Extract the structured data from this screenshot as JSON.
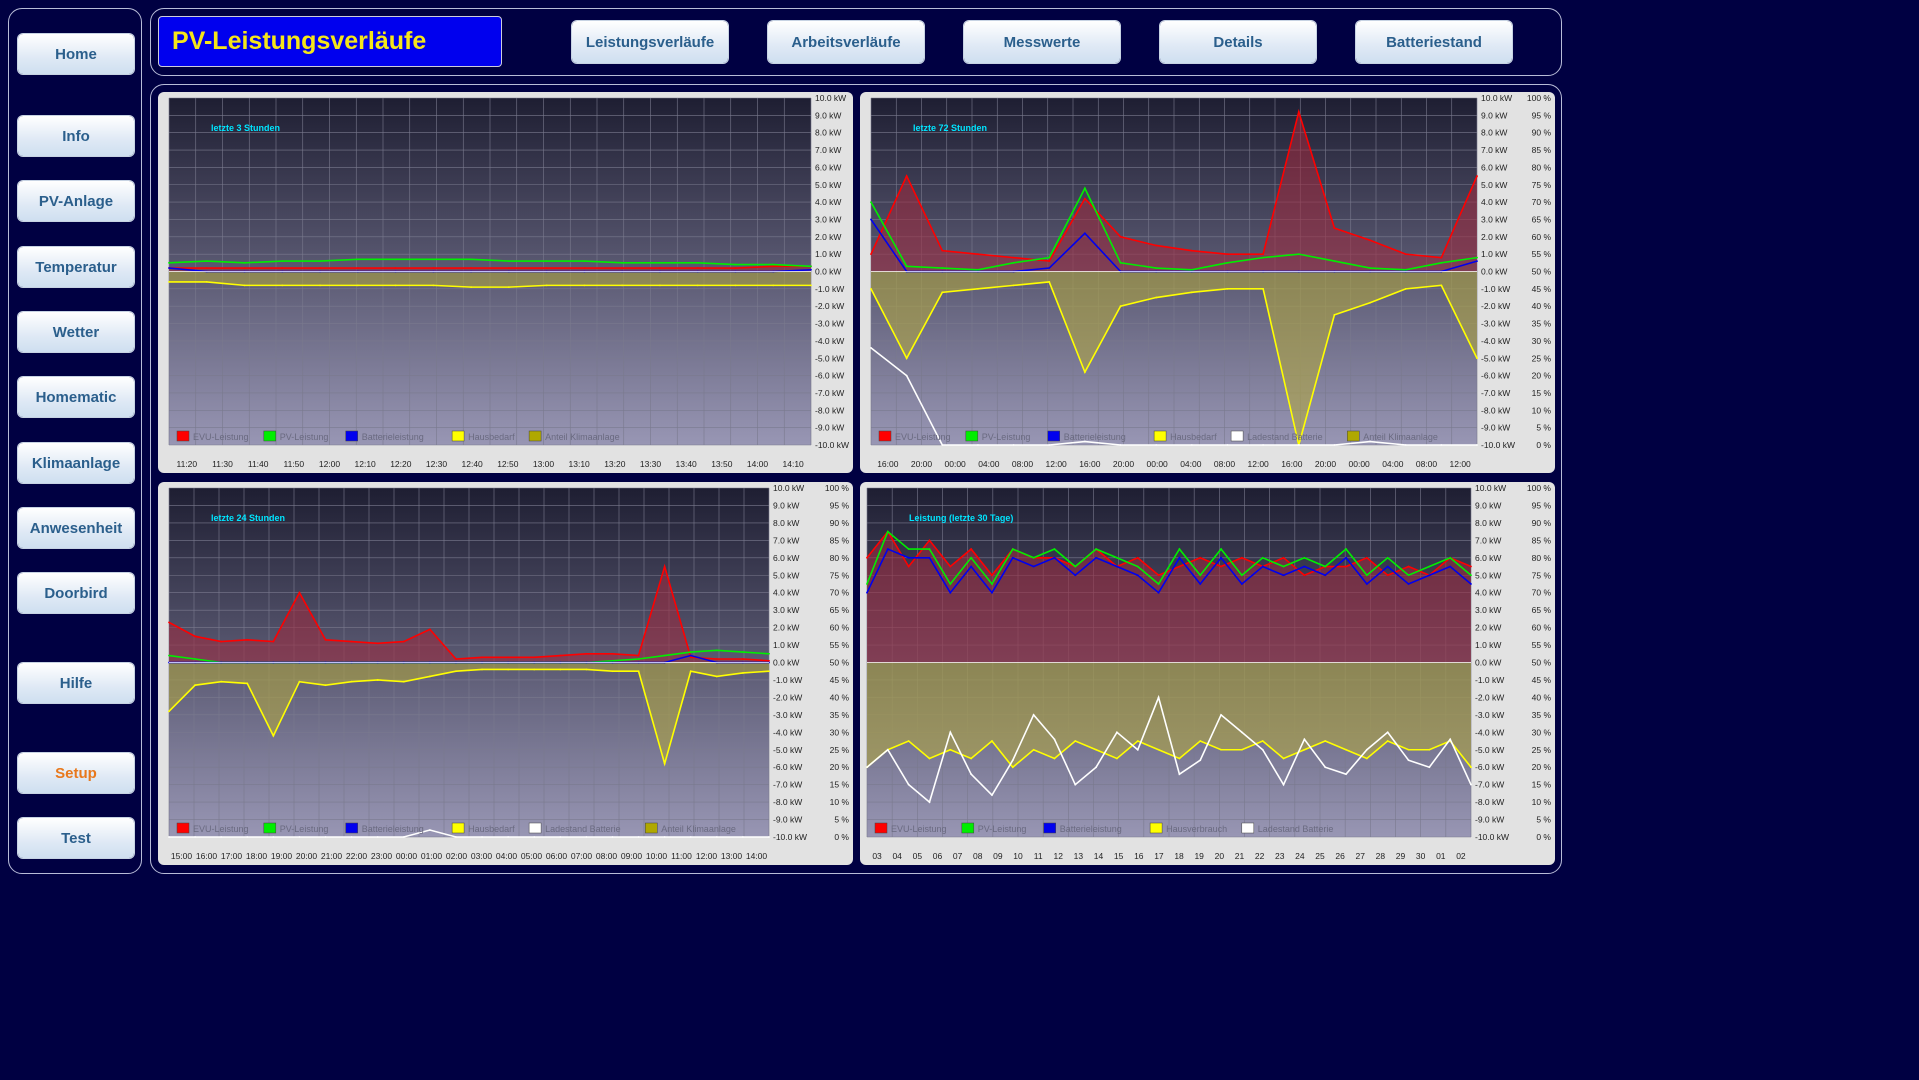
{
  "sidebar": {
    "items": [
      {
        "label": "Home"
      },
      {
        "label": "Info"
      },
      {
        "label": "PV-Anlage"
      },
      {
        "label": "Temperatur"
      },
      {
        "label": "Wetter"
      },
      {
        "label": "Homematic"
      },
      {
        "label": "Klimaanlage"
      },
      {
        "label": "Anwesenheit"
      },
      {
        "label": "Doorbird"
      },
      {
        "label": "Hilfe"
      },
      {
        "label": "Setup"
      },
      {
        "label": "Test"
      }
    ]
  },
  "header": {
    "title": "PV-Leistungsverläufe",
    "tabs": [
      {
        "label": "Leistungsverläufe"
      },
      {
        "label": "Arbeitsverläufe"
      },
      {
        "label": "Messwerte"
      },
      {
        "label": "Details"
      },
      {
        "label": "Batteriestand"
      }
    ]
  },
  "colors": {
    "background": "#000042",
    "title_bg": "#0000ee",
    "title_text": "#f5e619",
    "evu": "#ff0000",
    "pv": "#00ee00",
    "battery": "#0000ee",
    "house": "#ffff00",
    "soc": "#ffffff",
    "aircon": "#b0a800"
  },
  "chart_data": [
    {
      "type": "area",
      "title": "letzte 3 Stunden",
      "y_ticks_kw": [
        "10.0 kW",
        "9.0 kW",
        "8.0 kW",
        "7.0 kW",
        "6.0 kW",
        "5.0 kW",
        "4.0 kW",
        "3.0 kW",
        "2.0 kW",
        "1.0 kW",
        "0.0 kW",
        "-1.0 kW",
        "-2.0 kW",
        "-3.0 kW",
        "-4.0 kW",
        "-5.0 kW",
        "-6.0 kW",
        "-7.0 kW",
        "-8.0 kW",
        "-9.0 kW",
        "-10.0 kW"
      ],
      "ylim": [
        -10,
        10
      ],
      "x_ticks": [
        "11:20",
        "11:30",
        "11:40",
        "11:50",
        "12:00",
        "12:10",
        "12:20",
        "12:30",
        "12:40",
        "12:50",
        "13:00",
        "13:10",
        "13:20",
        "13:30",
        "13:40",
        "13:50",
        "14:00",
        "14:10"
      ],
      "legend": [
        "EVU-Leistung",
        "PV-Leistung",
        "Batterieleistung",
        "Hausbedarf",
        "Anteil Klimaanlage"
      ],
      "series": [
        {
          "name": "EVU-Leistung",
          "values": [
            0.2,
            0.2,
            0.2,
            0.2,
            0.2,
            0.2,
            0.2,
            0.2,
            0.2,
            0.2,
            0.2,
            0.2,
            0.2,
            0.2,
            0.2,
            0.2,
            0.3,
            0.3
          ]
        },
        {
          "name": "PV-Leistung",
          "values": [
            0.5,
            0.6,
            0.5,
            0.6,
            0.6,
            0.7,
            0.7,
            0.7,
            0.7,
            0.6,
            0.6,
            0.6,
            0.5,
            0.5,
            0.5,
            0.4,
            0.4,
            0.3
          ]
        },
        {
          "name": "Batterieleistung",
          "values": [
            0.2,
            0.0,
            0.0,
            0.0,
            0.0,
            0.0,
            0.0,
            0.0,
            0.0,
            0.0,
            0.0,
            0.0,
            0.0,
            0.0,
            0.0,
            0.0,
            0.0,
            0.1
          ]
        },
        {
          "name": "Hausbedarf",
          "values": [
            -0.6,
            -0.6,
            -0.8,
            -0.8,
            -0.8,
            -0.8,
            -0.8,
            -0.8,
            -0.9,
            -0.9,
            -0.8,
            -0.8,
            -0.8,
            -0.8,
            -0.8,
            -0.8,
            -0.8,
            -0.8
          ]
        }
      ]
    },
    {
      "type": "area",
      "title": "letzte 72 Stunden",
      "y_ticks_kw": [
        "10.0 kW",
        "9.0 kW",
        "8.0 kW",
        "7.0 kW",
        "6.0 kW",
        "5.0 kW",
        "4.0 kW",
        "3.0 kW",
        "2.0 kW",
        "1.0 kW",
        "0.0 kW",
        "-1.0 kW",
        "-2.0 kW",
        "-3.0 kW",
        "-4.0 kW",
        "-5.0 kW",
        "-6.0 kW",
        "-7.0 kW",
        "-8.0 kW",
        "-9.0 kW",
        "-10.0 kW"
      ],
      "y_ticks_pct": [
        "100 %",
        "95 %",
        "90 %",
        "85 %",
        "80 %",
        "75 %",
        "70 %",
        "65 %",
        "60 %",
        "55 %",
        "50 %",
        "45 %",
        "40 %",
        "35 %",
        "30 %",
        "25 %",
        "20 %",
        "15 %",
        "10 %",
        "5 %",
        "0 %"
      ],
      "ylim": [
        -10,
        10
      ],
      "x_ticks": [
        "16:00",
        "20:00",
        "00:00",
        "04:00",
        "08:00",
        "12:00",
        "16:00",
        "20:00",
        "00:00",
        "04:00",
        "08:00",
        "12:00",
        "16:00",
        "20:00",
        "00:00",
        "04:00",
        "08:00",
        "12:00"
      ],
      "legend": [
        "EVU-Leistung",
        "PV-Leistung",
        "Batterieleistung",
        "Hausbedarf",
        "Ladestand Batterie",
        "Anteil Klimaanlage"
      ],
      "series": [
        {
          "name": "EVU-Leistung",
          "values": [
            1.0,
            5.5,
            1.2,
            1.0,
            0.8,
            0.6,
            4.2,
            2.0,
            1.5,
            1.2,
            1.0,
            1.0,
            9.2,
            2.5,
            1.8,
            1.0,
            0.8,
            5.5
          ]
        },
        {
          "name": "PV-Leistung",
          "values": [
            4.0,
            0.3,
            0.2,
            0.1,
            0.5,
            0.8,
            4.8,
            0.5,
            0.2,
            0.1,
            0.5,
            0.8,
            1.0,
            0.6,
            0.2,
            0.1,
            0.5,
            0.8
          ]
        },
        {
          "name": "Batterieleistung",
          "values": [
            3.0,
            0.0,
            0.0,
            0.0,
            0.0,
            0.2,
            2.2,
            0.0,
            0.0,
            0.0,
            0.0,
            0.0,
            0.0,
            0.0,
            0.0,
            0.0,
            0.0,
            0.6
          ]
        },
        {
          "name": "Hausbedarf",
          "values": [
            -1.0,
            -5.0,
            -1.2,
            -1.0,
            -0.8,
            -0.6,
            -5.8,
            -2.0,
            -1.5,
            -1.2,
            -1.0,
            -1.0,
            -10.0,
            -2.5,
            -1.8,
            -1.0,
            -0.8,
            -5.0
          ]
        },
        {
          "name": "Ladestand Batterie",
          "values": [
            28,
            20,
            0,
            0,
            0,
            0,
            1,
            0,
            0,
            0,
            0,
            0,
            0,
            0,
            1,
            0,
            0,
            0
          ]
        }
      ]
    },
    {
      "type": "area",
      "title": "letzte 24 Stunden",
      "y_ticks_kw": [
        "10.0 kW",
        "9.0 kW",
        "8.0 kW",
        "7.0 kW",
        "6.0 kW",
        "5.0 kW",
        "4.0 kW",
        "3.0 kW",
        "2.0 kW",
        "1.0 kW",
        "0.0 kW",
        "-1.0 kW",
        "-2.0 kW",
        "-3.0 kW",
        "-4.0 kW",
        "-5.0 kW",
        "-6.0 kW",
        "-7.0 kW",
        "-8.0 kW",
        "-9.0 kW",
        "-10.0 kW"
      ],
      "y_ticks_pct": [
        "100 %",
        "95 %",
        "90 %",
        "85 %",
        "80 %",
        "75 %",
        "70 %",
        "65 %",
        "60 %",
        "55 %",
        "50 %",
        "45 %",
        "40 %",
        "35 %",
        "30 %",
        "25 %",
        "20 %",
        "15 %",
        "10 %",
        "5 %",
        "0 %"
      ],
      "ylim": [
        -10,
        10
      ],
      "x_ticks": [
        "15:00",
        "16:00",
        "17:00",
        "18:00",
        "19:00",
        "20:00",
        "21:00",
        "22:00",
        "23:00",
        "00:00",
        "01:00",
        "02:00",
        "03:00",
        "04:00",
        "05:00",
        "06:00",
        "07:00",
        "08:00",
        "09:00",
        "10:00",
        "11:00",
        "12:00",
        "13:00",
        "14:00"
      ],
      "legend": [
        "EVU-Leistung",
        "PV-Leistung",
        "Batterieleistung",
        "Hausbedarf",
        "Ladestand Batterie",
        "Anteil Klimaanlage"
      ],
      "series": [
        {
          "name": "EVU-Leistung",
          "values": [
            2.3,
            1.5,
            1.2,
            1.3,
            1.2,
            4.0,
            1.3,
            1.2,
            1.1,
            1.2,
            1.9,
            0.2,
            0.3,
            0.3,
            0.3,
            0.4,
            0.5,
            0.5,
            0.4,
            5.5,
            0.3,
            0.2,
            0.2,
            0.1
          ]
        },
        {
          "name": "PV-Leistung",
          "values": [
            0.4,
            0.2,
            0.0,
            0.0,
            0.0,
            0.0,
            0.0,
            0.0,
            0.0,
            0.0,
            0.0,
            0.0,
            0.0,
            0.0,
            0.0,
            0.0,
            0.0,
            0.1,
            0.2,
            0.4,
            0.6,
            0.7,
            0.6,
            0.5
          ]
        },
        {
          "name": "Batterieleistung",
          "values": [
            0.0,
            0.0,
            0.0,
            0.0,
            0.0,
            0.0,
            0.0,
            0.0,
            0.0,
            0.0,
            0.0,
            0.0,
            0.0,
            0.0,
            0.0,
            0.0,
            0.0,
            0.0,
            0.0,
            0.0,
            0.4,
            0.0,
            0.0,
            0.0
          ]
        },
        {
          "name": "Hausbedarf",
          "values": [
            -2.8,
            -1.3,
            -1.1,
            -1.2,
            -4.2,
            -1.1,
            -1.3,
            -1.1,
            -1.0,
            -1.1,
            -0.8,
            -0.5,
            -0.4,
            -0.4,
            -0.4,
            -0.4,
            -0.4,
            -0.5,
            -0.5,
            -5.8,
            -0.5,
            -0.8,
            -0.6,
            -0.5
          ]
        },
        {
          "name": "Ladestand Batterie",
          "values": [
            0,
            0,
            0,
            0,
            0,
            0,
            0,
            0,
            0,
            0,
            2,
            0,
            0,
            0,
            0,
            0,
            0,
            0,
            0,
            0,
            0,
            0,
            0,
            0
          ]
        }
      ]
    },
    {
      "type": "area",
      "title": "Leistung (letzte 30 Tage)",
      "y_ticks_kw": [
        "10.0 kW",
        "9.0 kW",
        "8.0 kW",
        "7.0 kW",
        "6.0 kW",
        "5.0 kW",
        "4.0 kW",
        "3.0 kW",
        "2.0 kW",
        "1.0 kW",
        "0.0 kW",
        "-1.0 kW",
        "-2.0 kW",
        "-3.0 kW",
        "-4.0 kW",
        "-5.0 kW",
        "-6.0 kW",
        "-7.0 kW",
        "-8.0 kW",
        "-9.0 kW",
        "-10.0 kW"
      ],
      "y_ticks_pct": [
        "100 %",
        "95 %",
        "90 %",
        "85 %",
        "80 %",
        "75 %",
        "70 %",
        "65 %",
        "60 %",
        "55 %",
        "50 %",
        "45 %",
        "40 %",
        "35 %",
        "30 %",
        "25 %",
        "20 %",
        "15 %",
        "10 %",
        "5 %",
        "0 %"
      ],
      "ylim": [
        -10,
        10
      ],
      "x_ticks": [
        "03",
        "04",
        "05",
        "06",
        "07",
        "08",
        "09",
        "10",
        "11",
        "12",
        "13",
        "14",
        "15",
        "16",
        "17",
        "18",
        "19",
        "20",
        "21",
        "22",
        "23",
        "24",
        "25",
        "26",
        "27",
        "28",
        "29",
        "30",
        "01",
        "02"
      ],
      "legend": [
        "EVU-Leistung",
        "PV-Leistung",
        "Batterieleistung",
        "Hausverbrauch",
        "Ladestand Batterie"
      ],
      "series": [
        {
          "name": "EVU-Leistung",
          "values": [
            6.0,
            7.5,
            5.5,
            7.0,
            5.5,
            6.5,
            5.0,
            6.5,
            6.0,
            6.0,
            5.5,
            6.5,
            5.5,
            6.0,
            5.0,
            5.5,
            6.0,
            5.5,
            6.0,
            5.5,
            6.0,
            5.0,
            5.5,
            5.5,
            6.0,
            5.0,
            5.5,
            5.0,
            6.0,
            5.5
          ]
        },
        {
          "name": "PV-Leistung",
          "values": [
            4.5,
            7.5,
            6.5,
            6.5,
            4.5,
            6.0,
            4.5,
            6.5,
            6.0,
            6.5,
            5.5,
            6.5,
            6.0,
            5.5,
            4.5,
            6.5,
            5.0,
            6.5,
            5.0,
            6.0,
            5.5,
            6.0,
            5.5,
            6.5,
            5.0,
            6.0,
            5.0,
            5.5,
            6.0,
            5.0
          ]
        },
        {
          "name": "Batterieleistung",
          "values": [
            4.0,
            6.5,
            6.0,
            6.0,
            4.0,
            5.5,
            4.0,
            6.0,
            5.5,
            6.0,
            5.0,
            6.0,
            5.5,
            5.0,
            4.0,
            6.0,
            4.5,
            6.0,
            4.5,
            5.5,
            5.0,
            5.5,
            5.0,
            6.0,
            4.5,
            5.5,
            4.5,
            5.0,
            5.5,
            4.5
          ]
        },
        {
          "name": "Hausverbrauch",
          "values": [
            -6.0,
            -5.0,
            -4.5,
            -5.5,
            -5.0,
            -5.5,
            -4.5,
            -6.0,
            -5.0,
            -5.5,
            -4.5,
            -5.0,
            -5.5,
            -4.5,
            -5.0,
            -5.5,
            -4.5,
            -5.0,
            -5.0,
            -4.5,
            -5.5,
            -5.0,
            -4.5,
            -5.0,
            -5.5,
            -4.5,
            -5.0,
            -5.0,
            -4.5,
            -6.0
          ]
        },
        {
          "name": "Ladestand Batterie",
          "values": [
            20,
            25,
            15,
            10,
            30,
            18,
            12,
            22,
            35,
            28,
            15,
            20,
            30,
            25,
            40,
            18,
            22,
            35,
            30,
            25,
            15,
            28,
            20,
            18,
            25,
            30,
            22,
            20,
            28,
            15
          ]
        }
      ]
    }
  ]
}
